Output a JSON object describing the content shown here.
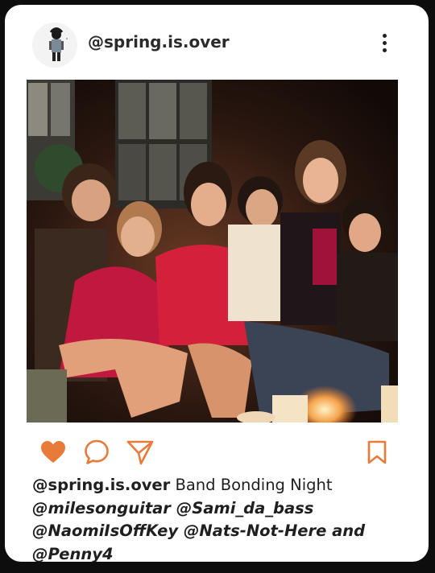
{
  "post": {
    "username": "@spring.is.over",
    "caption": {
      "user": "@spring.is.over",
      "text": " Band Bonding Night",
      "mentions_line1": "@milesonguitar @Sami_da_bass",
      "mentions_line2": "@NaomiIsOffKey @Nats-Not-Here and",
      "mentions_line3": "@Penny4"
    }
  },
  "colors": {
    "accent": "#e87a3a",
    "background": "#0d0d0d",
    "card": "#ffffff",
    "text": "#1f1f1f"
  },
  "icons": {
    "like": "heart-icon",
    "comment": "comment-bubble-icon",
    "share": "paper-plane-icon",
    "save": "bookmark-icon",
    "more": "vertical-dots-icon"
  }
}
